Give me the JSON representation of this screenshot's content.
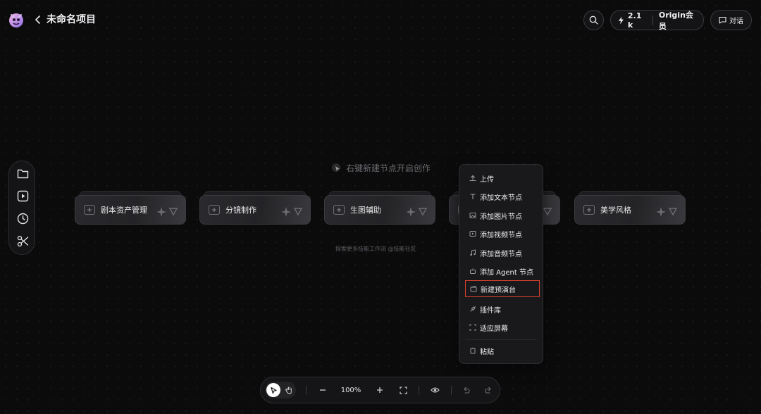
{
  "header": {
    "project_title": "未命名项目",
    "credits": "2.1 k",
    "membership": "Origin会员",
    "chat_label": "对话"
  },
  "canvas": {
    "hint": "右键新建节点开启创作",
    "community_link": "探索更多技能工作流 @技能社区",
    "skill_cards": [
      {
        "label": "剧本资产管理"
      },
      {
        "label": "分镜制作"
      },
      {
        "label": "生图辅助"
      },
      {
        "label": ""
      },
      {
        "label": "美学风格"
      }
    ]
  },
  "context_menu": {
    "items": [
      {
        "label": "上传",
        "icon": "upload-icon"
      },
      {
        "label": "添加文本节点",
        "icon": "text-icon"
      },
      {
        "label": "添加图片节点",
        "icon": "image-icon"
      },
      {
        "label": "添加视频节点",
        "icon": "video-icon"
      },
      {
        "label": "添加音频节点",
        "icon": "music-icon"
      },
      {
        "label": "添加 Agent 节点",
        "icon": "agent-icon"
      },
      {
        "label": "新建预演台",
        "icon": "clapperboard-icon",
        "highlighted": true
      },
      {
        "label": "插件库",
        "icon": "plugin-icon"
      },
      {
        "label": "适应屏幕",
        "icon": "fit-screen-icon"
      },
      {
        "label": "粘贴",
        "icon": "paste-icon"
      }
    ]
  },
  "left_toolbar": {
    "icons": [
      "folder-icon",
      "video-play-icon",
      "clock-icon",
      "scissors-icon"
    ]
  },
  "bottom_toolbar": {
    "zoom": "100%"
  },
  "colors": {
    "background": "#0b0b0c",
    "highlight_border": "#d9402e",
    "panel": "#19191b"
  }
}
